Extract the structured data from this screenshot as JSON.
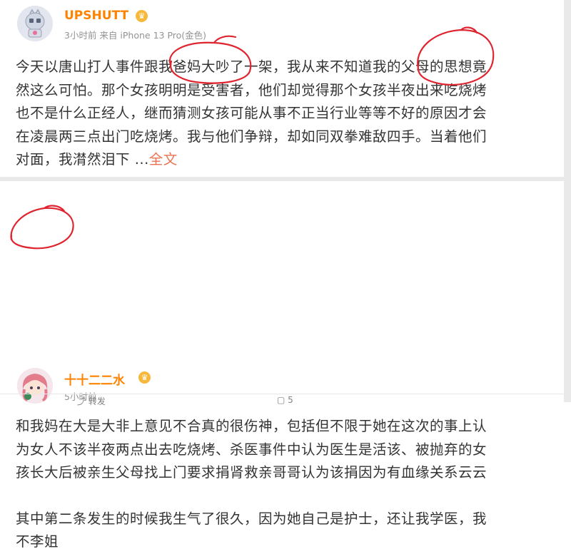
{
  "post1": {
    "username": "UPSHUTT",
    "vip_badge": "♛",
    "meta": "3小时前 来自 iPhone 13 Pro(金色)",
    "lines": [
      "今天以唐山打人事件跟我爸妈大吵了一架，我从来不知道我的父母的思想竟",
      "然这么可怕。那个女孩明明是受害者，他们却觉得那个女孩半夜出来吃烧烤",
      "也不是什么正经人，继而猜测女孩可能从事不正当行业等等不好的原因才会",
      "在凌晨两三点出门吃烧烤。我与他们争辩，却如同双拳难敌四手。当着他们",
      "对面，我潸然泪下 ..."
    ],
    "full_text_link": "全文"
  },
  "post2": {
    "username": "十十二二水",
    "vip_badge": "♛",
    "meta": "5小时前",
    "para1_lines": [
      "和我妈在大是大非上意见不合真的很伤神，包括但不限于她在这次的事上认",
      "为女人不该半夜两点出去吃烧烤、杀医事件中认为医生是活该、被抛弃的女",
      "孩长大后被亲生父母找上门要求捐肾救亲哥哥认为该捐因为有血缘关系云云"
    ],
    "para2_lines": [
      "其中第二条发生的时候我生气了很久，因为她自己是护士，还让我学医，我",
      "不李姐"
    ]
  },
  "actions": {
    "repost_label": "转发",
    "comment_count": "5"
  },
  "colors": {
    "username": "#ff8200",
    "link": "#eb7350",
    "annotation": "#e0242f"
  }
}
